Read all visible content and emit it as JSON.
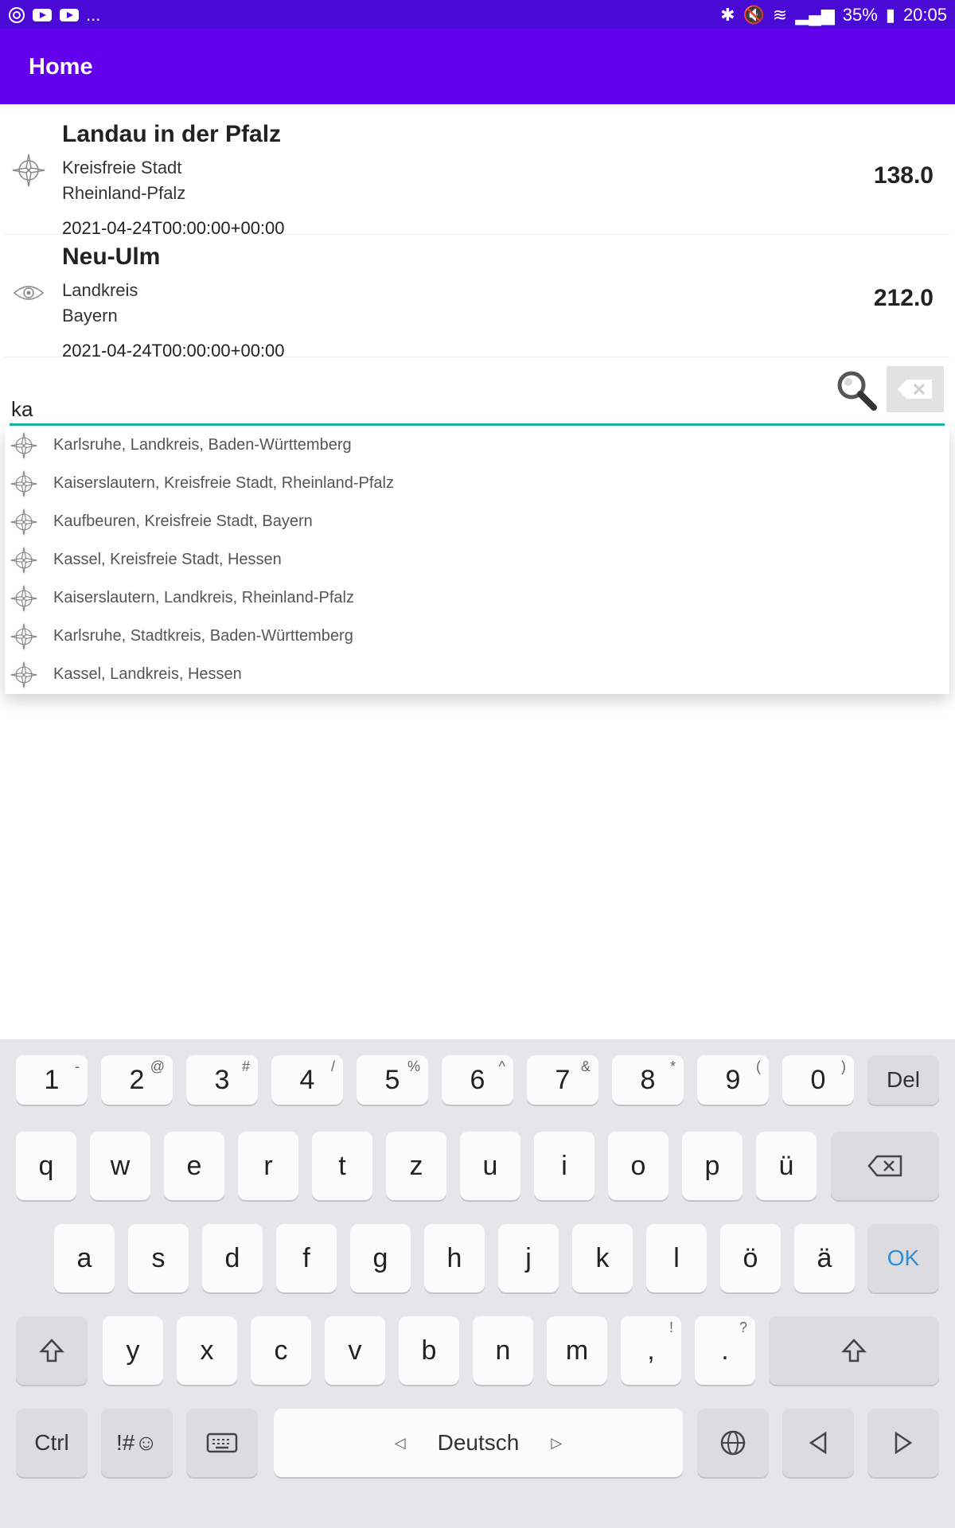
{
  "status_bar": {
    "left_icons": [
      "sync-icon",
      "youtube-icon",
      "youtube-icon"
    ],
    "more": "...",
    "battery": "35%",
    "time": "20:05",
    "right_icons": [
      "bluetooth-icon",
      "mute-icon",
      "wifi-icon",
      "signal-icon",
      "battery-icon"
    ]
  },
  "appbar": {
    "title": "Home"
  },
  "cards": [
    {
      "icon": "compass-rose-icon",
      "name": "Landau in der Pfalz",
      "type": "Kreisfreie Stadt",
      "state": "Rheinland-Pfalz",
      "date": "2021-04-24T00:00:00+00:00",
      "value": "138.0"
    },
    {
      "icon": "eye-icon",
      "name": "Neu-Ulm",
      "type": "Landkreis",
      "state": "Bayern",
      "date": "2021-04-24T00:00:00+00:00",
      "value": "212.0"
    }
  ],
  "search": {
    "value": "ka"
  },
  "suggestions": [
    "Karlsruhe, Landkreis, Baden-Württemberg",
    "Kaiserslautern, Kreisfreie Stadt, Rheinland-Pfalz",
    "Kaufbeuren, Kreisfreie Stadt, Bayern",
    "Kassel, Kreisfreie Stadt, Hessen",
    "Kaiserslautern, Landkreis, Rheinland-Pfalz",
    "Karlsruhe, Stadtkreis, Baden-Württemberg",
    "Kassel, Landkreis, Hessen"
  ],
  "keyboard": {
    "row_numbers": [
      {
        "k": "1",
        "s": "-"
      },
      {
        "k": "2",
        "s": "@"
      },
      {
        "k": "3",
        "s": "#"
      },
      {
        "k": "4",
        "s": "/"
      },
      {
        "k": "5",
        "s": "%"
      },
      {
        "k": "6",
        "s": "^"
      },
      {
        "k": "7",
        "s": "&"
      },
      {
        "k": "8",
        "s": "*"
      },
      {
        "k": "9",
        "s": "("
      },
      {
        "k": "0",
        "s": ")"
      }
    ],
    "del": "Del",
    "row1": [
      "q",
      "w",
      "e",
      "r",
      "t",
      "z",
      "u",
      "i",
      "o",
      "p",
      "ü"
    ],
    "row2": [
      "a",
      "s",
      "d",
      "f",
      "g",
      "h",
      "j",
      "k",
      "l",
      "ö",
      "ä"
    ],
    "ok": "OK",
    "row3": [
      "y",
      "x",
      "c",
      "v",
      "b",
      "n",
      "m"
    ],
    "comma": ",",
    "comma_sup": "!",
    "period": ".",
    "period_sup": "?",
    "ctrl": "Ctrl",
    "symbols": "!#☺",
    "space_label": "Deutsch"
  }
}
